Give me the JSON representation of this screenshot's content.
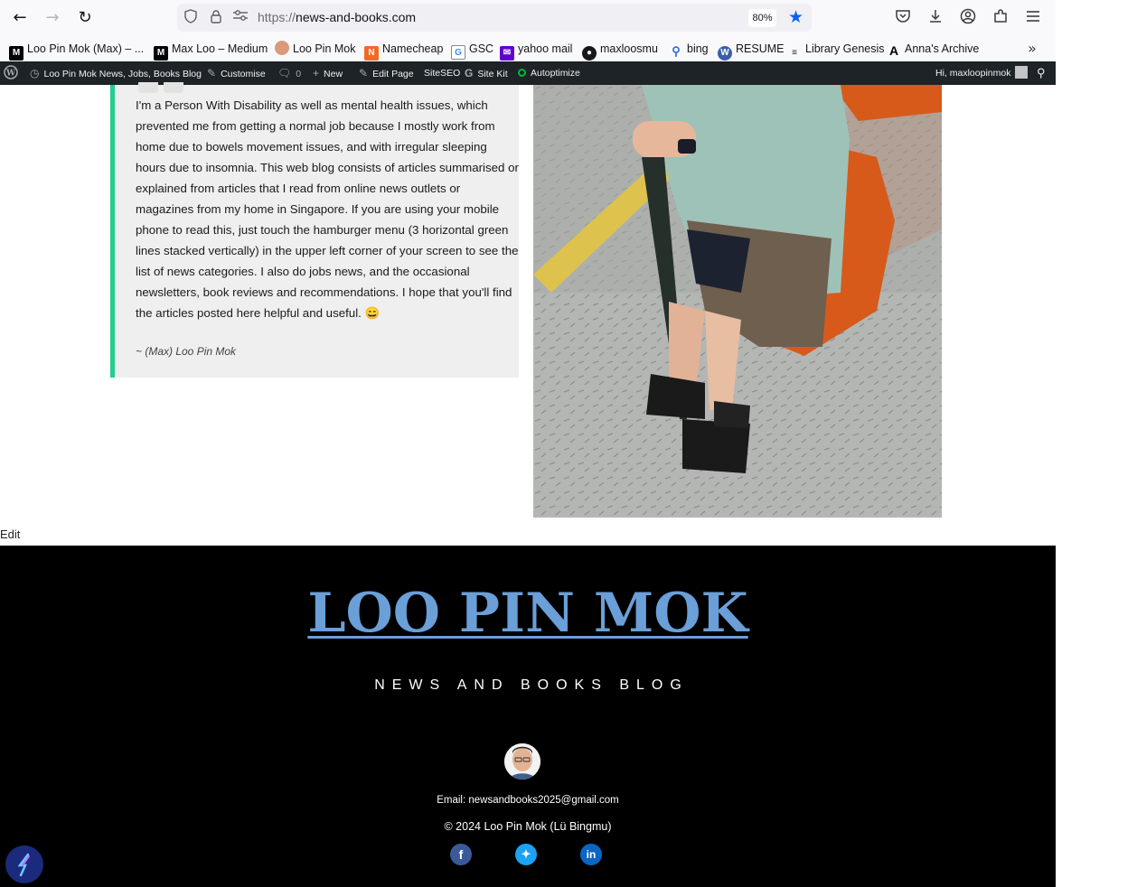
{
  "browser": {
    "url_protocol": "https://",
    "url_host": "news-and-books.com",
    "zoom": "80%",
    "bookmarks": [
      {
        "label": "Loo Pin Mok (Max) – ...",
        "icon": "medium-icon"
      },
      {
        "label": "Max Loo – Medium",
        "icon": "medium-icon"
      },
      {
        "label": "Loo Pin Mok",
        "icon": "avatar-icon"
      },
      {
        "label": "Namecheap",
        "icon": "namecheap-icon"
      },
      {
        "label": "GSC",
        "icon": "gsc-icon"
      },
      {
        "label": "yahoo mail",
        "icon": "yahoo-icon"
      },
      {
        "label": "maxloosmu",
        "icon": "github-icon"
      },
      {
        "label": "bing",
        "icon": "search-icon"
      },
      {
        "label": "RESUME",
        "icon": "wordpress-icon"
      },
      {
        "label": "Library Genesis",
        "icon": "libgen-icon"
      },
      {
        "label": "Anna's Archive",
        "icon": "annas-archive-icon"
      }
    ]
  },
  "adminbar": {
    "site": "Loo Pin Mok News, Jobs, Books Blog",
    "customise": "Customise",
    "comments": "0",
    "new": "New",
    "edit_page": "Edit Page",
    "siteseo": "SiteSEO",
    "sitekit": "Site Kit",
    "autoptimize": "Autoptimize",
    "greeting": "Hi, maxloopinmok"
  },
  "content": {
    "quote": "I'm a Person With Disability as well as mental health issues, which prevented me from getting a normal job because I mostly work from home due to bowels movement issues, and with irregular sleeping hours due to insomnia. This web blog consists of articles summarised or explained from articles that I read from online news outlets or magazines from my home in Singapore. If you are using your mobile phone to read this, just touch the hamburger menu (3 horizontal green lines stacked vertically) in the upper left corner of your screen to see the list of news categories. I also do jobs news, and the occasional newsletters, book reviews and recommendations. I hope that you'll find the articles posted here helpful and useful. 😄",
    "signature": "~ (Max) Loo Pin Mok",
    "edit": "Edit"
  },
  "footer": {
    "title": "LOO PIN MOK",
    "subtitle": "NEWS AND BOOKS BLOG",
    "email": "Email: newsandbooks2025@gmail.com",
    "copyright": "© 2024 Loo Pin Mok (Lü Bingmu)",
    "social": [
      "facebook-icon",
      "twitter-icon",
      "linkedin-icon"
    ]
  },
  "colors": {
    "accent_green": "#22cf8e",
    "title_blue": "#6a9fd8",
    "adminbar": "#1d2327"
  }
}
